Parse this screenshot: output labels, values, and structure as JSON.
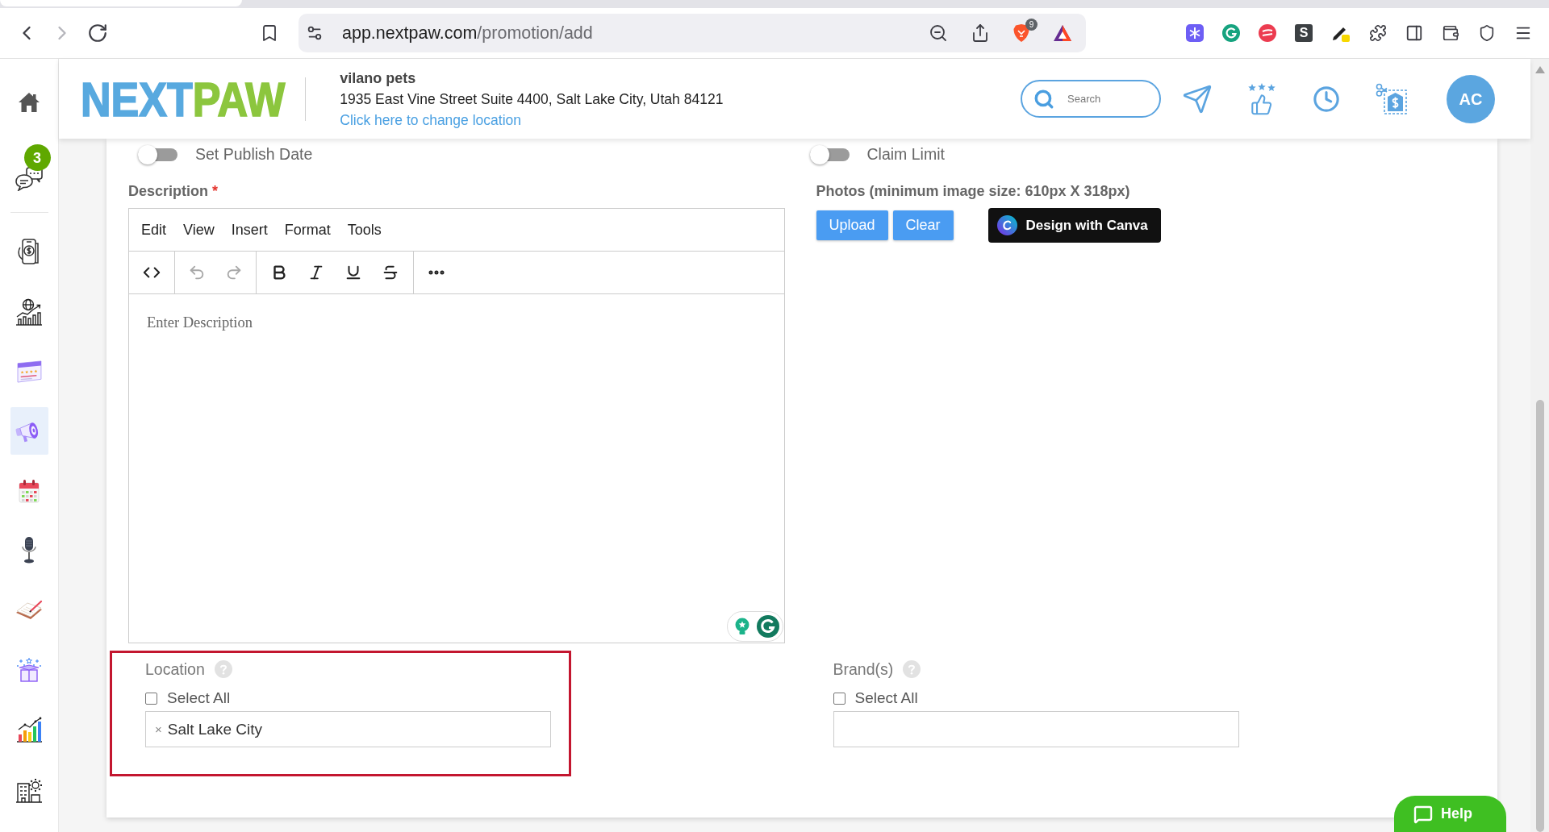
{
  "browser": {
    "back": {
      "disabled": false
    },
    "forward": {
      "disabled": true
    },
    "url_host": "app.nextpaw.com",
    "url_path": "/promotion/add",
    "shield_badge": "9",
    "extension_letter": "S"
  },
  "sidebar": {
    "top_items": [
      {
        "selected": false
      },
      {
        "selected": false,
        "badge": "3"
      }
    ],
    "items": [
      {
        "selected": false
      },
      {
        "selected": false
      },
      {
        "selected": false
      },
      {
        "selected": true
      },
      {
        "selected": false
      },
      {
        "selected": false
      },
      {
        "selected": false
      },
      {
        "selected": false
      },
      {
        "selected": false
      },
      {
        "selected": false
      }
    ]
  },
  "header": {
    "logo": {
      "part_1": "NEXT",
      "part_2": "PAW"
    },
    "store_name": "vilano pets",
    "address": "1935 East Vine Street Suite 4400, Salt Lake City, Utah 84121",
    "change_location_link": "Click here to change location",
    "search": {
      "placeholder": "Search"
    },
    "avatar_initials": "AC"
  },
  "form": {
    "toggles": [
      {
        "label": "Set Publish Date",
        "on": false
      },
      {
        "label": "Claim Limit",
        "on": false
      }
    ],
    "description": {
      "label": "Description",
      "required_mark": "*",
      "editor": {
        "menu": [
          "Edit",
          "View",
          "Insert",
          "Format",
          "Tools"
        ],
        "undo": {
          "disabled": true
        },
        "redo": {
          "disabled": true
        },
        "placeholder": "Enter Description"
      }
    },
    "photos": {
      "label": "Photos (minimum image size: 610px X 318px)",
      "buttons": [
        "Upload",
        "Clear"
      ],
      "canva_button": "Design with Canva"
    },
    "location": {
      "label": "Location",
      "highlighted": true,
      "select_all": {
        "label": "Select All",
        "checked": false
      },
      "tags": [
        {
          "label": "Salt Lake City",
          "remove": "×"
        }
      ]
    },
    "brands": {
      "label": "Brand(s)",
      "select_all": {
        "label": "Select All",
        "checked": false
      }
    }
  },
  "help_button": {
    "label": "Help"
  }
}
